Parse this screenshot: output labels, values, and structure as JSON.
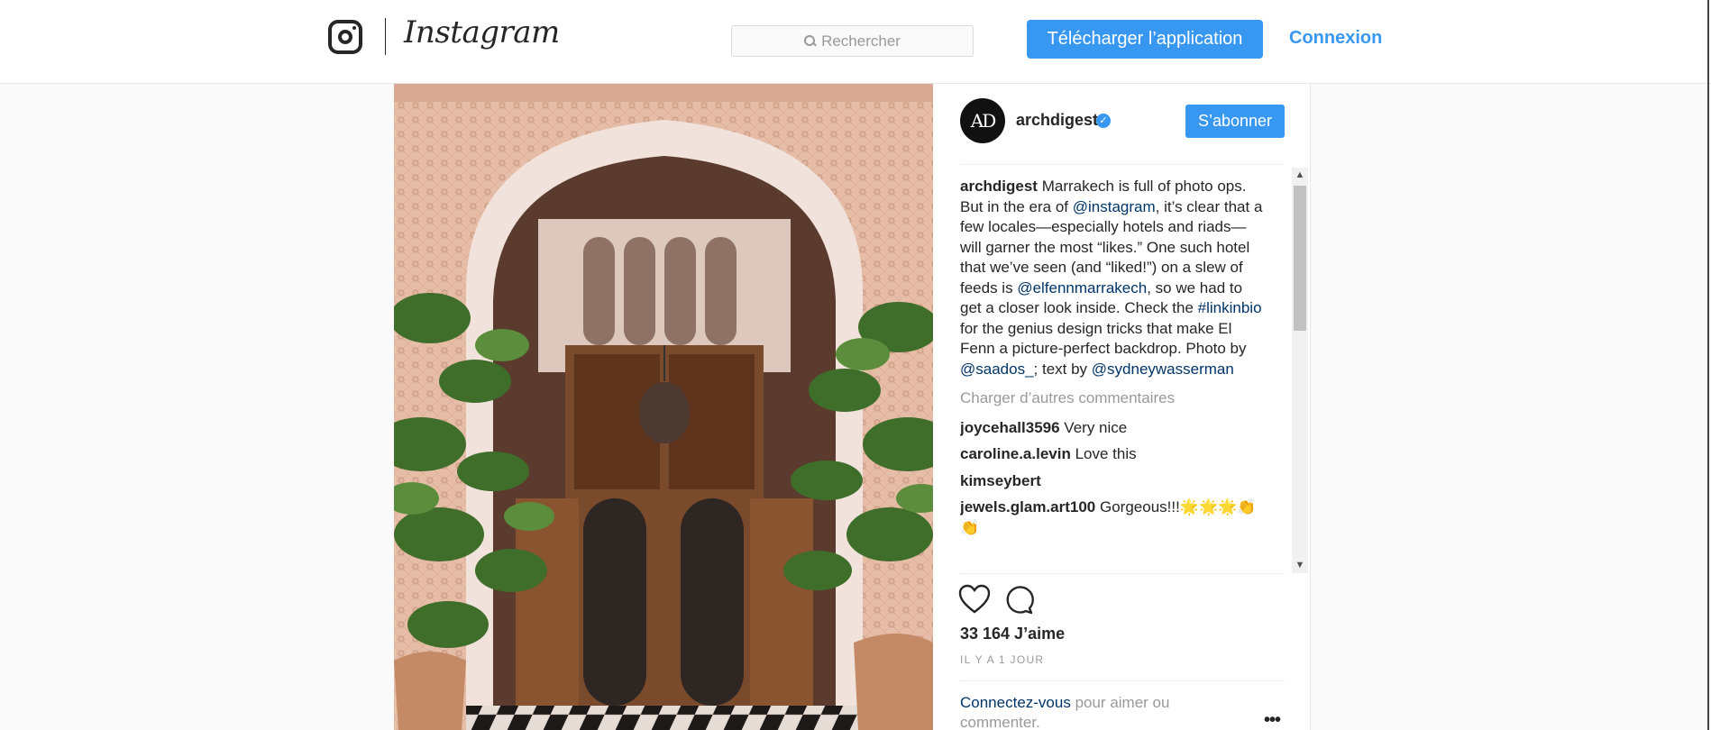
{
  "header": {
    "brand": "Instagram",
    "search_placeholder": "Rechercher",
    "download_label": "Télécharger l’application",
    "login_label": "Connexion"
  },
  "post": {
    "username": "archdigest",
    "verified": true,
    "avatar_text": "AD",
    "follow_label": "S’abonner",
    "caption": {
      "user": "archdigest",
      "t1": " Marrakech is full of photo ops. But in the era of ",
      "m1": "@instagram",
      "t2": ", it’s clear that a few locales—especially hotels and riads—will garner the most “likes.” One such hotel that we’ve seen (and “liked!”) on a slew of feeds is ",
      "m2": "@elfennmarrakech",
      "t3": ", so we had to get a closer look inside. Check the ",
      "m3": "#linkinbio",
      "t4": " for the genius design tricks that make El Fenn a picture-perfect backdrop. Photo by ",
      "m4": "@saados_",
      "t5": "; text by ",
      "m5": "@sydneywasserman"
    },
    "load_more": "Charger d’autres commentaires",
    "comments": [
      {
        "user": "joycehall3596",
        "text": " Very nice"
      },
      {
        "user": "caroline.a.levin",
        "text": " Love this"
      },
      {
        "user": "kimseybert",
        "text": ""
      },
      {
        "user": "jewels.glam.art100",
        "text": " Gorgeous!!!🌟🌟🌟👏👏"
      }
    ],
    "likes": "33 164 J’aime",
    "timestamp": "IL Y A 1 JOUR",
    "login_prompt": {
      "link": "Connectez-vous",
      "text": " pour aimer ou commenter."
    },
    "more_glyph": "•••"
  },
  "colors": {
    "accent": "#3897f0",
    "mention": "#003569",
    "muted": "#999999"
  },
  "icons": [
    "instagram-glyph-icon",
    "search-icon",
    "verified-icon",
    "heart-icon",
    "comment-icon",
    "more-options-icon"
  ]
}
